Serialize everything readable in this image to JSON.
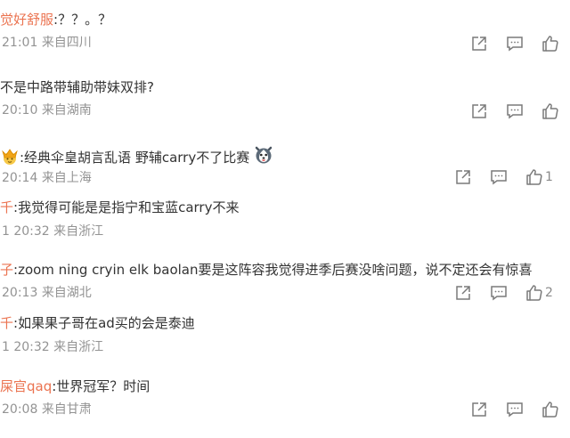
{
  "comments": [
    {
      "user": "觉好舒服",
      "text": ":？？。？",
      "time": "21:01",
      "location": "来自四川",
      "likes": ""
    },
    {
      "user": "",
      "text": "不是中路带辅助带妹双排?",
      "time": "20:10",
      "location": "来自湖南",
      "likes": ""
    },
    {
      "user": "",
      "text": ":经典伞皇胡言乱语 野辅carry不了比赛",
      "time": "20:14",
      "location": "来自上海",
      "likes": "1",
      "emoji_before": "crown-emoji",
      "emoji_after": "husky-emoji"
    },
    {
      "user": "千",
      "text": ":我觉得可能是是指宁和宝蓝carry不来",
      "time": "1 20:32",
      "location": "来自浙江",
      "likes": ""
    },
    {
      "user": "子",
      "text": ":zoom ning cryin elk baolan要是这阵容我觉得进季后赛没啥问题，说不定还会有惊喜",
      "time": "20:13",
      "location": "来自湖北",
      "likes": "2"
    },
    {
      "user": "千",
      "text": ":如果果子哥在ad买的会是泰迪",
      "time": "1 20:32",
      "location": "来自浙江",
      "likes": ""
    },
    {
      "user": "屎官qaq",
      "text": ":世界冠军？时间",
      "time": "20:08",
      "location": "来自甘肃",
      "likes": ""
    }
  ],
  "icons": {
    "forward": "share-icon",
    "reply": "comment-icon",
    "like": "thumbs-up-icon"
  },
  "colors": {
    "username": "#eb7350",
    "text": "#333333",
    "meta": "#939393",
    "icon": "#7a7a7a"
  }
}
